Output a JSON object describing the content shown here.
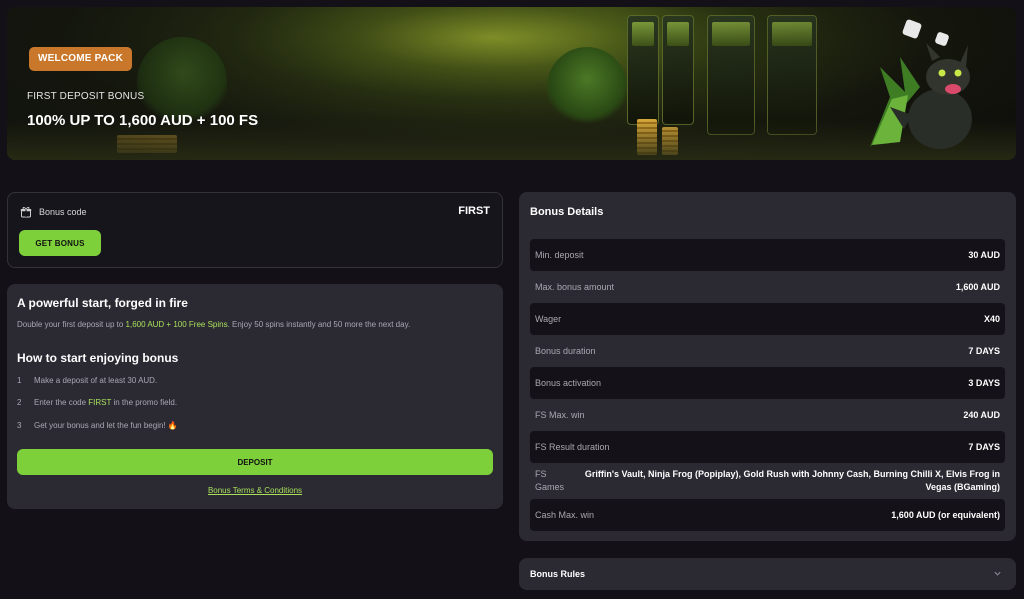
{
  "banner": {
    "pill": "WELCOME PACK",
    "subtitle": "FIRST DEPOSIT BONUS",
    "title": "100% UP TO 1,600 AUD + 100 FS"
  },
  "code_card": {
    "label": "Bonus code",
    "code": "FIRST",
    "button": "GET BONUS",
    "icon": "gift-icon"
  },
  "info": {
    "title": "A powerful start, forged in fire",
    "desc_pre": "Double your first deposit up to ",
    "desc_highlight": "1,600 AUD + 100 Free Spins",
    "desc_post": ". Enjoy 50 spins instantly and 50 more the next day.",
    "how_title": "How to start enjoying bonus",
    "steps": [
      {
        "num": "1",
        "text": "Make a deposit of at least 30 AUD."
      },
      {
        "num": "2",
        "pre": "Enter the code ",
        "code": "FIRST",
        "post": " in the promo field."
      },
      {
        "num": "3",
        "text": "Get your bonus and let the fun begin! 🔥"
      }
    ],
    "deposit_button": "DEPOSIT",
    "terms_link": "Bonus Terms & Conditions"
  },
  "details": {
    "title": "Bonus Details",
    "rows": [
      {
        "key": "Min. deposit",
        "value": "30 AUD"
      },
      {
        "key": "Max. bonus amount",
        "value": "1,600 AUD"
      },
      {
        "key": "Wager",
        "value": "X40"
      },
      {
        "key": "Bonus duration",
        "value": "7 DAYS"
      },
      {
        "key": "Bonus activation",
        "value": "3 DAYS"
      },
      {
        "key": "FS Max. win",
        "value": "240 AUD"
      },
      {
        "key": "FS Result duration",
        "value": "7 DAYS"
      },
      {
        "key": "FS Games",
        "value": "Griffin's Vault, Ninja Frog (Popiplay), Gold Rush with Johnny Cash, Burning Chilli X, Elvis Frog in Vegas (BGaming)"
      },
      {
        "key": "Cash Max. win",
        "value": "1,600 AUD (or equivalent)"
      }
    ]
  },
  "rules": {
    "title": "Bonus Rules",
    "icon": "chevron-down-icon"
  },
  "colors": {
    "accent_green": "#7dd03a",
    "highlight_green": "#a8e05a",
    "pill_orange": "#c9772a",
    "background": "#131117",
    "panel": "#2b2a33"
  }
}
